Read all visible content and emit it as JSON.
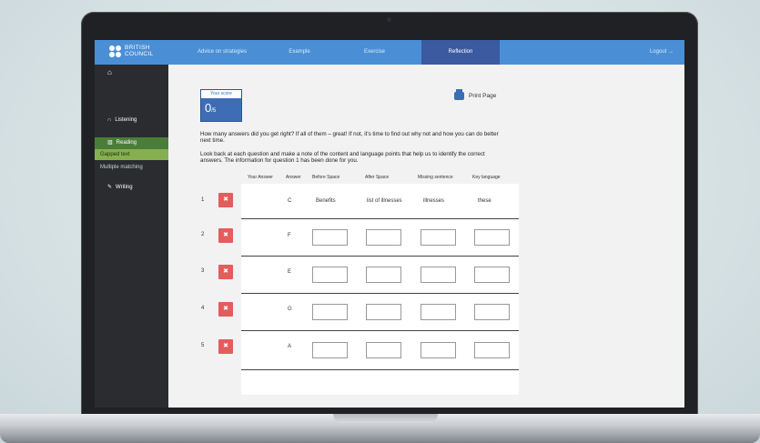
{
  "brand": {
    "line1": "BRITISH",
    "line2": "COUNCIL"
  },
  "nav": {
    "tabs": [
      {
        "label": "Advice on strategies"
      },
      {
        "label": "Example"
      },
      {
        "label": "Exercise"
      },
      {
        "label": "Reflection"
      }
    ],
    "logout": "Logout →"
  },
  "sidebar": {
    "home_icon": "home-icon",
    "items": [
      {
        "label": "Listening",
        "icon": "headphones-icon"
      },
      {
        "label": "Reading",
        "icon": "book-icon"
      },
      {
        "label": "Gapped text"
      },
      {
        "label": "Multiple matching"
      },
      {
        "label": "Writing",
        "icon": "pen-icon"
      }
    ]
  },
  "score": {
    "label": "Your score",
    "value": "0",
    "total": "/5"
  },
  "print": {
    "label": "Print Page"
  },
  "instructions": {
    "p1": "How many answers did you get right? If all of them – great! If not, it’s time to find out why not and how you can do better next time.",
    "p2": "Look back at each question and make a note of the content and language points that help us to identify the correct answers. The information for question 1 has been done for you."
  },
  "table": {
    "headers": [
      "Your Answer",
      "Answer",
      "Before Space",
      "After Space",
      "Missing sentence",
      "Key language"
    ],
    "rows": [
      {
        "num": "1",
        "mark": "✖",
        "answer": "C",
        "before": "Benefits",
        "after": "list of illnesses",
        "missing": "illnesses",
        "key": "these"
      },
      {
        "num": "2",
        "mark": "✖",
        "answer": "F"
      },
      {
        "num": "3",
        "mark": "✖",
        "answer": "E"
      },
      {
        "num": "4",
        "mark": "✖",
        "answer": "G"
      },
      {
        "num": "5",
        "mark": "✖",
        "answer": "A"
      }
    ]
  },
  "colors": {
    "nav": "#4a8fd6",
    "active_tab": "#3b5aa0",
    "sidebar": "#2a2c2f",
    "reading": "#4b7d3a",
    "wrong": "#e35d5d"
  }
}
